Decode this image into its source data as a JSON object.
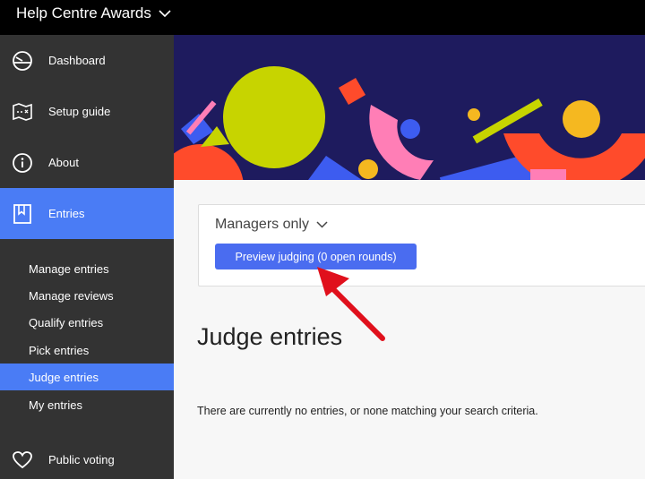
{
  "app": {
    "title": "Help Centre Awards"
  },
  "sidebar": {
    "items": [
      {
        "label": "Dashboard",
        "icon": "dashboard-icon"
      },
      {
        "label": "Setup guide",
        "icon": "map-icon"
      },
      {
        "label": "About",
        "icon": "info-icon"
      },
      {
        "label": "Entries",
        "icon": "bookmark-icon",
        "active": true
      },
      {
        "label": "Public voting",
        "icon": "heart-icon"
      }
    ],
    "sub_items": [
      {
        "label": "Manage entries"
      },
      {
        "label": "Manage reviews"
      },
      {
        "label": "Qualify entries"
      },
      {
        "label": "Pick entries"
      },
      {
        "label": "Judge entries",
        "active": true
      },
      {
        "label": "My entries"
      }
    ]
  },
  "card": {
    "managers_label": "Managers only",
    "preview_button_label": "Preview judging (0 open rounds)"
  },
  "main": {
    "page_title": "Judge entries",
    "empty_message": "There are currently no entries, or none matching your search criteria."
  },
  "colors": {
    "accent": "#4a7cf5",
    "button": "#4a6cf0",
    "sidebar_bg": "#333333",
    "topbar_bg": "#000000",
    "hero_bg": "#1e1b5e",
    "annotation_arrow": "#e0101c"
  }
}
